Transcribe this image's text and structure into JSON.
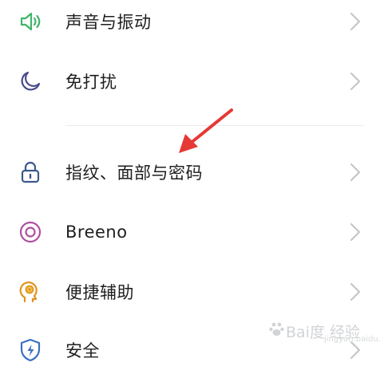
{
  "settings": {
    "items": [
      {
        "label": "声音与振动",
        "icon": "speaker-icon",
        "color": "#3fb46a"
      },
      {
        "label": "免打扰",
        "icon": "moon-icon",
        "color": "#4a4a8c"
      },
      {
        "label": "指纹、面部与密码",
        "icon": "lock-icon",
        "color": "#3c5a8a"
      },
      {
        "label": "Breeno",
        "icon": "breeno-icon",
        "color": "#b04fa0"
      },
      {
        "label": "便捷辅助",
        "icon": "head-bulb-icon",
        "color": "#e0931c"
      },
      {
        "label": "安全",
        "icon": "shield-bolt-icon",
        "color": "#3a6fc4"
      }
    ]
  },
  "annotation": {
    "arrow_color": "#e53935"
  },
  "watermark": {
    "text": "Bai度 经验",
    "subtext": "jingyan.baidu.com"
  }
}
